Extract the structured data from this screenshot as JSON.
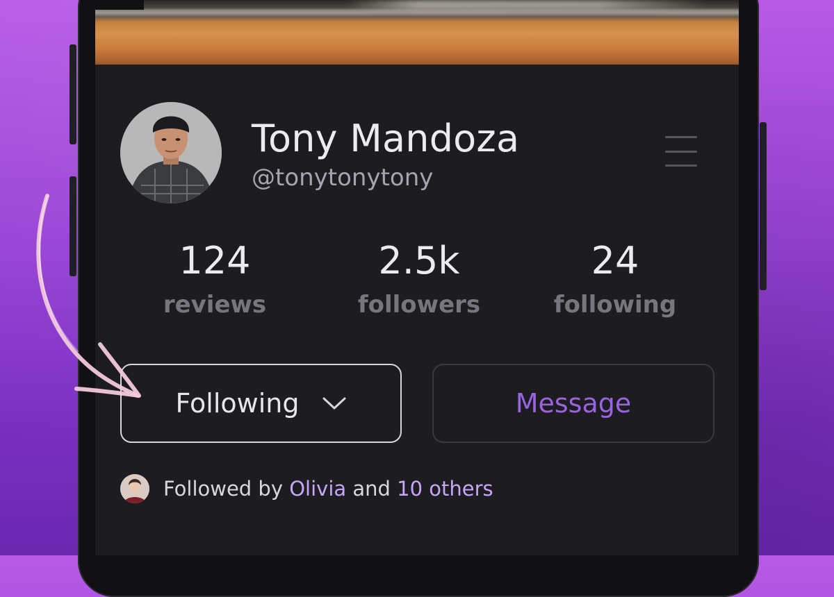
{
  "profile": {
    "name": "Tony Mandoza",
    "handle": "@tonytonytony"
  },
  "stats": [
    {
      "value": "124",
      "label": "reviews"
    },
    {
      "value": "2.5k",
      "label": "followers"
    },
    {
      "value": "24",
      "label": "following"
    }
  ],
  "actions": {
    "following_label": "Following",
    "message_label": "Message"
  },
  "followed_by": {
    "prefix": "Followed by",
    "name": "Olivia",
    "middle": "and",
    "others": "10 others"
  },
  "colors": {
    "background": "#9a44d8",
    "screen": "#1d1c21",
    "accent": "#9a64e0",
    "link": "#c7a6f6",
    "annotation_arrow": "#f2c9dc"
  },
  "icons": {
    "menu": "hamburger-menu-icon",
    "following_dropdown": "chevron-down-icon",
    "annotation": "hand-drawn-arrow"
  }
}
